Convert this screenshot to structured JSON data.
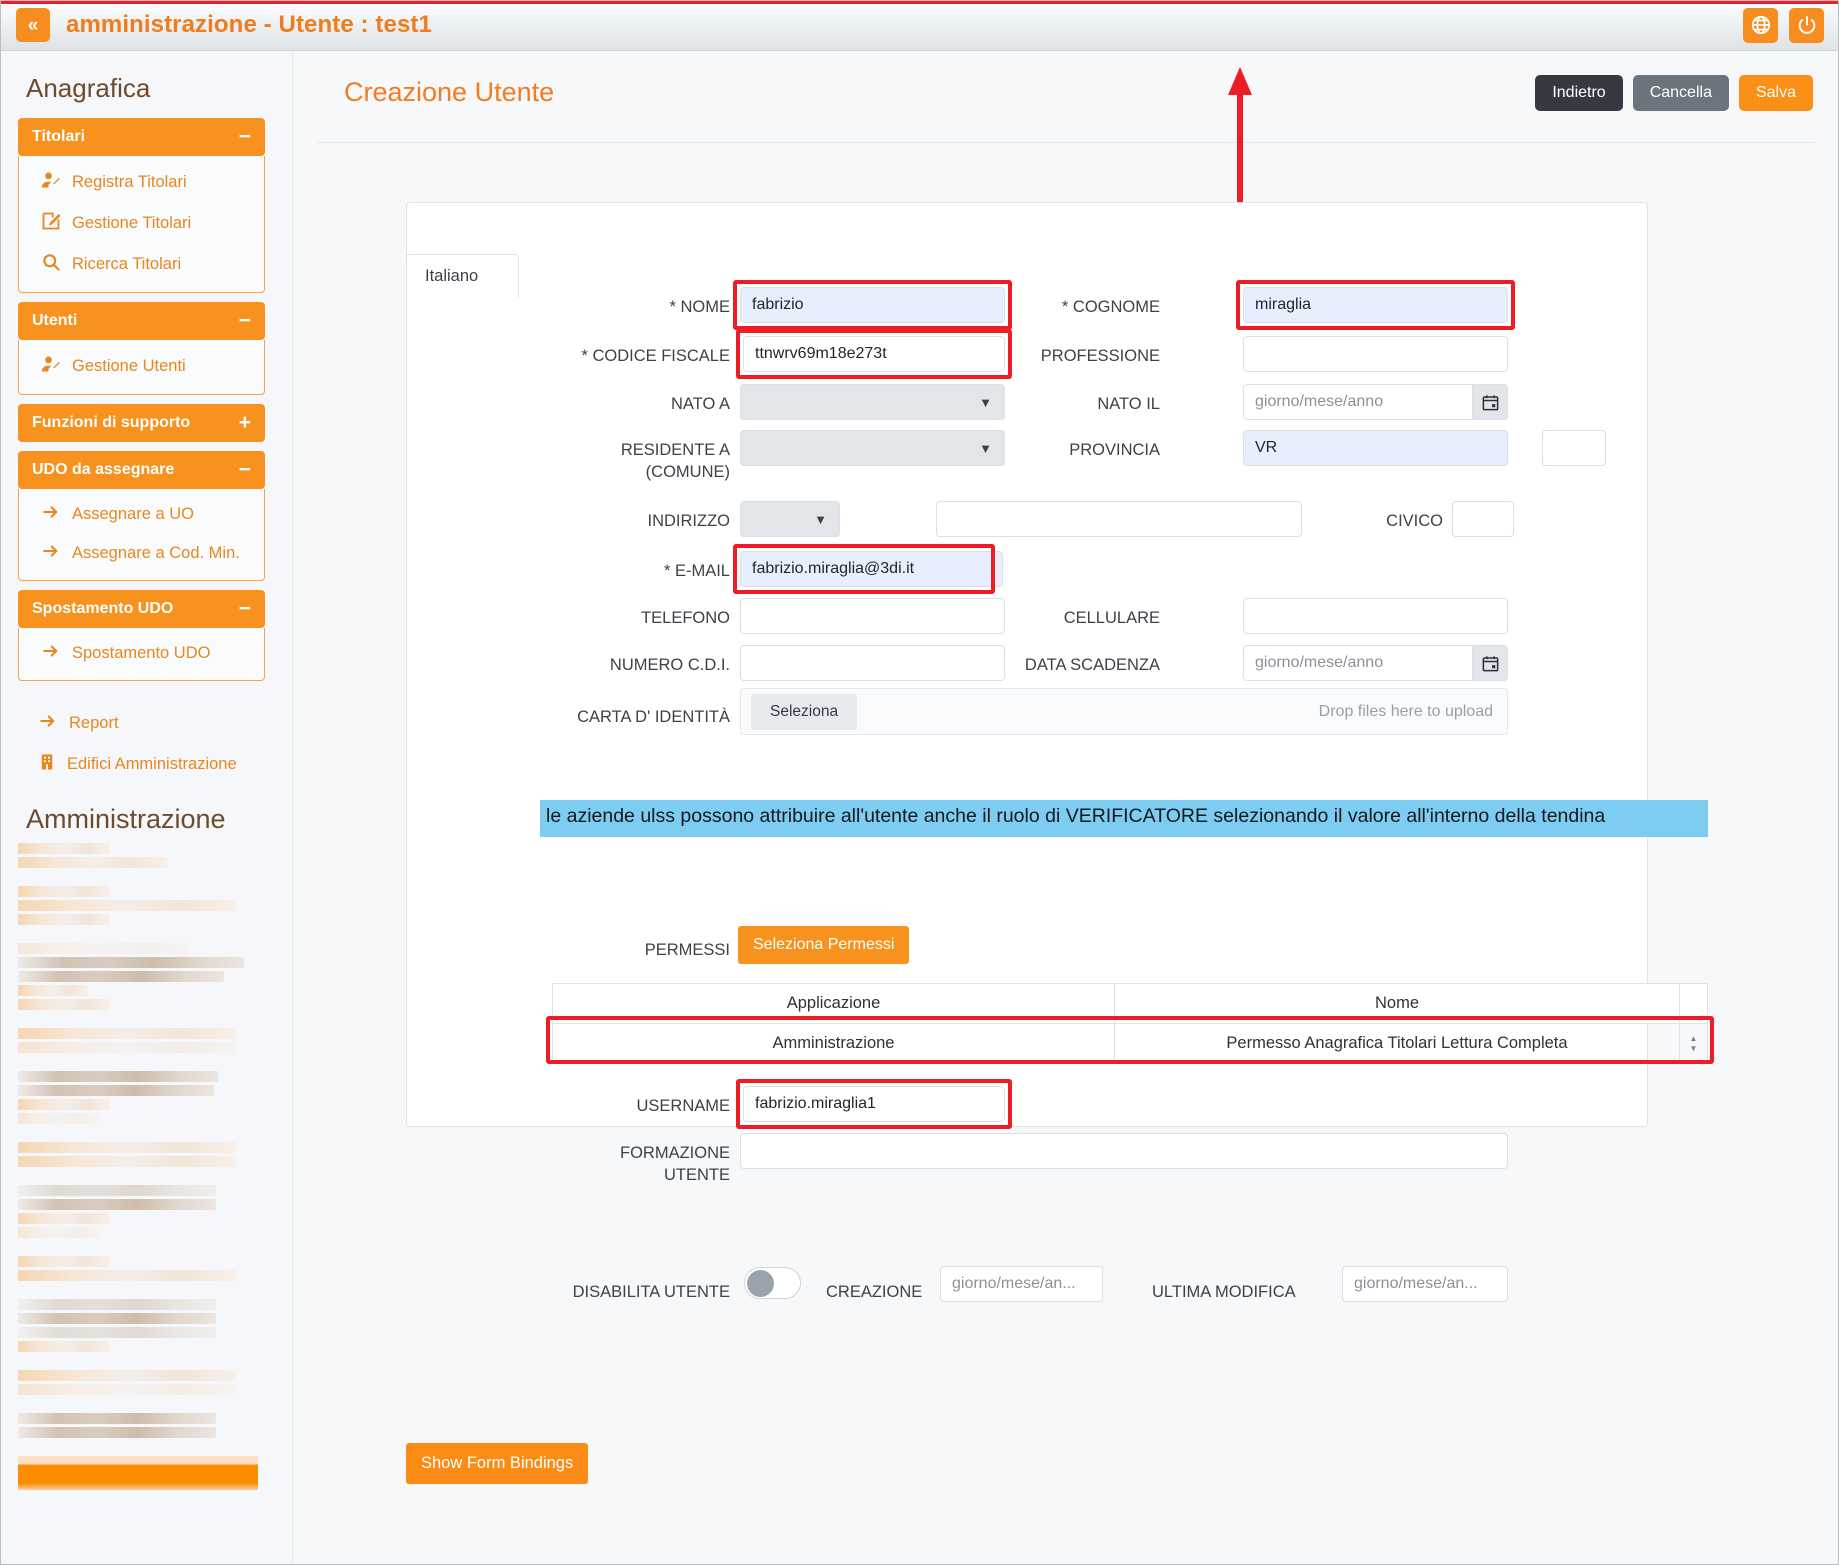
{
  "topbar": {
    "collapse_icon": "double-chevron-left-icon",
    "title": "amministrazione - Utente : test1",
    "globe_icon": "globe-icon",
    "power_icon": "power-icon"
  },
  "sidebar": {
    "title": "Anagrafica",
    "groups": [
      {
        "label": "Titolari",
        "toggle": "−",
        "items": [
          {
            "icon": "user-add-icon",
            "label": "Registra Titolari"
          },
          {
            "icon": "edit-square-icon",
            "label": "Gestione Titolari"
          },
          {
            "icon": "search-icon",
            "label": "Ricerca Titolari"
          }
        ]
      },
      {
        "label": "Utenti",
        "toggle": "−",
        "items": [
          {
            "icon": "user-add-icon",
            "label": "Gestione Utenti"
          }
        ]
      },
      {
        "label": "Funzioni di supporto",
        "toggle": "+",
        "items": []
      },
      {
        "label": "UDO da assegnare",
        "toggle": "−",
        "items": [
          {
            "icon": "arrow-right-icon",
            "label": "Assegnare a UO"
          },
          {
            "icon": "arrow-right-icon",
            "label": "Assegnare a Cod. Min."
          }
        ]
      },
      {
        "label": "Spostamento UDO",
        "toggle": "−",
        "items": [
          {
            "icon": "arrow-right-icon",
            "label": "Spostamento UDO"
          }
        ]
      }
    ],
    "loose_items": [
      {
        "icon": "arrow-right-icon",
        "label": "Report"
      },
      {
        "icon": "building-icon",
        "label": "Edifici Amministrazione"
      }
    ],
    "section_title": "Amministrazione",
    "redacted_note": ""
  },
  "page": {
    "title": "Creazione Utente",
    "actions": {
      "back": "Indietro",
      "cancel": "Cancella",
      "save": "Salva"
    },
    "lang_tab": "Italiano"
  },
  "form": {
    "nome": {
      "label": "* NOME",
      "value": "fabrizio",
      "highlighted": true
    },
    "cognome": {
      "label": "* COGNOME",
      "value": "miraglia",
      "highlighted": true
    },
    "codice_fiscale": {
      "label": "* CODICE FISCALE",
      "value": "ttnwrv69m18e273t",
      "highlighted": true
    },
    "professione": {
      "label": "PROFESSIONE",
      "value": ""
    },
    "nato_a": {
      "label": "NATO A",
      "value": ""
    },
    "nato_il": {
      "label": "NATO IL",
      "placeholder": "giorno/mese/anno",
      "value": ""
    },
    "residente_a": {
      "label": "RESIDENTE A (COMUNE)",
      "label_l1": "RESIDENTE A",
      "label_l2": "(COMUNE)",
      "value": ""
    },
    "provincia": {
      "label": "PROVINCIA",
      "value": "VR"
    },
    "provincia_extra": {
      "value": ""
    },
    "indirizzo": {
      "label": "INDIRIZZO",
      "select_value": "",
      "text_value": ""
    },
    "civico": {
      "label": "CIVICO",
      "value": ""
    },
    "email": {
      "label": "* E-MAIL",
      "value": "fabrizio.miraglia@3di.it",
      "highlighted": true
    },
    "telefono": {
      "label": "TELEFONO",
      "value": ""
    },
    "cellulare": {
      "label": "CELLULARE",
      "value": ""
    },
    "numero_cdi": {
      "label": "NUMERO C.D.I.",
      "value": ""
    },
    "data_scadenza": {
      "label": "DATA SCADENZA",
      "placeholder": "giorno/mese/anno",
      "value": ""
    },
    "carta_identita": {
      "label": "CARTA D' IDENTITÀ",
      "select_button": "Seleziona",
      "drop_hint": "Drop files here to upload"
    },
    "username": {
      "label": "USERNAME",
      "value": "fabrizio.miraglia1",
      "highlighted": true
    },
    "formazione_utente": {
      "label": "FORMAZIONE UTENTE",
      "label_l1": "FORMAZIONE",
      "label_l2": "UTENTE",
      "value": ""
    },
    "disabilita_utente": {
      "label": "DISABILITA UTENTE",
      "state": "off"
    },
    "creazione": {
      "label": "CREAZIONE",
      "placeholder": "giorno/mese/an...",
      "value": ""
    },
    "ultima_modifica": {
      "label": "ULTIMA MODIFICA",
      "placeholder": "giorno/mese/an...",
      "value": ""
    }
  },
  "notice": "le aziende ulss possono attribuire all'utente anche il ruolo di VERIFICATORE selezionando il valore all'interno della tendina",
  "permissions": {
    "label": "PERMESSI",
    "button": "Seleziona Permessi",
    "columns": [
      "Applicazione",
      "Nome"
    ],
    "rows": [
      {
        "applicazione": "Amministrazione",
        "nome": "Permesso Anagrafica Titolari Lettura Completa"
      }
    ]
  },
  "footer": {
    "show_form_bindings": "Show Form Bindings"
  },
  "colors": {
    "brand_orange": "#f7921e",
    "title_orange": "#f07c1c",
    "highlight_red": "#ee1c25",
    "notice_blue": "#7dcdf2",
    "filled_field": "#e8eefc"
  }
}
